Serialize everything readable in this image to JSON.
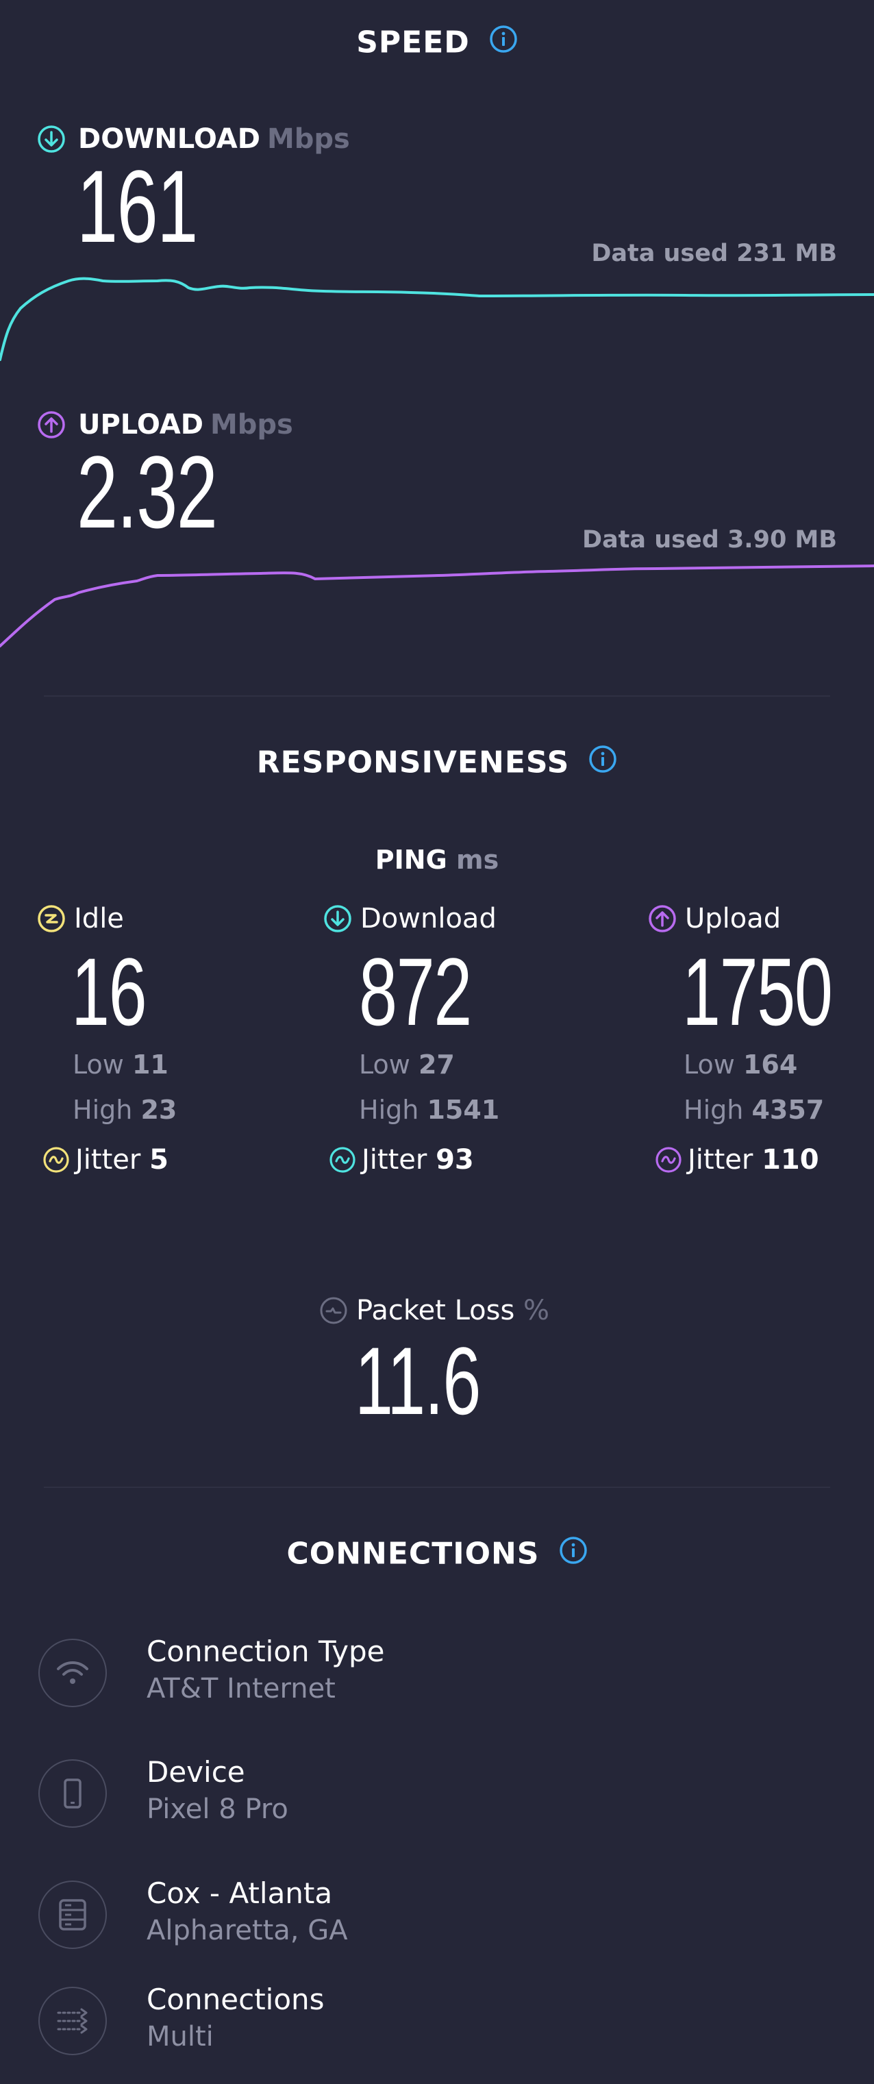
{
  "speed": {
    "title": "SPEED",
    "download": {
      "label": "DOWNLOAD",
      "unit": "Mbps",
      "value": "161",
      "data_used": "Data used 231 MB",
      "color": "#4fe3e0"
    },
    "upload": {
      "label": "UPLOAD",
      "unit": "Mbps",
      "value": "2.32",
      "data_used": "Data used 3.90 MB",
      "color": "#b86bf0"
    }
  },
  "responsiveness": {
    "title": "RESPONSIVENESS",
    "ping_label": "PING",
    "ping_unit": "ms",
    "idle": {
      "label": "Idle",
      "value": "16",
      "low_label": "Low",
      "low": "11",
      "high_label": "High",
      "high": "23",
      "jitter_label": "Jitter",
      "jitter": "5",
      "color": "#f3e27a"
    },
    "download": {
      "label": "Download",
      "value": "872",
      "low_label": "Low",
      "low": "27",
      "high_label": "High",
      "high": "1541",
      "jitter_label": "Jitter",
      "jitter": "93",
      "color": "#4fe3e0"
    },
    "upload": {
      "label": "Upload",
      "value": "1750",
      "low_label": "Low",
      "low": "164",
      "high_label": "High",
      "high": "4357",
      "jitter_label": "Jitter",
      "jitter": "110",
      "color": "#b86bf0"
    },
    "packet_loss": {
      "label": "Packet Loss",
      "unit": "%",
      "value": "11.6"
    }
  },
  "connections": {
    "title": "CONNECTIONS",
    "items": [
      {
        "title": "Connection Type",
        "value": "AT&T Internet",
        "icon": "wifi-icon"
      },
      {
        "title": "Device",
        "value": "Pixel 8 Pro",
        "icon": "phone-icon"
      },
      {
        "title": "Cox - Atlanta",
        "value": "Alpharetta, GA",
        "icon": "server-icon"
      },
      {
        "title": "Connections",
        "value": "Multi",
        "icon": "multi-connections-icon"
      }
    ]
  },
  "colors": {
    "background": "#252638",
    "info": "#3aa7f0"
  }
}
